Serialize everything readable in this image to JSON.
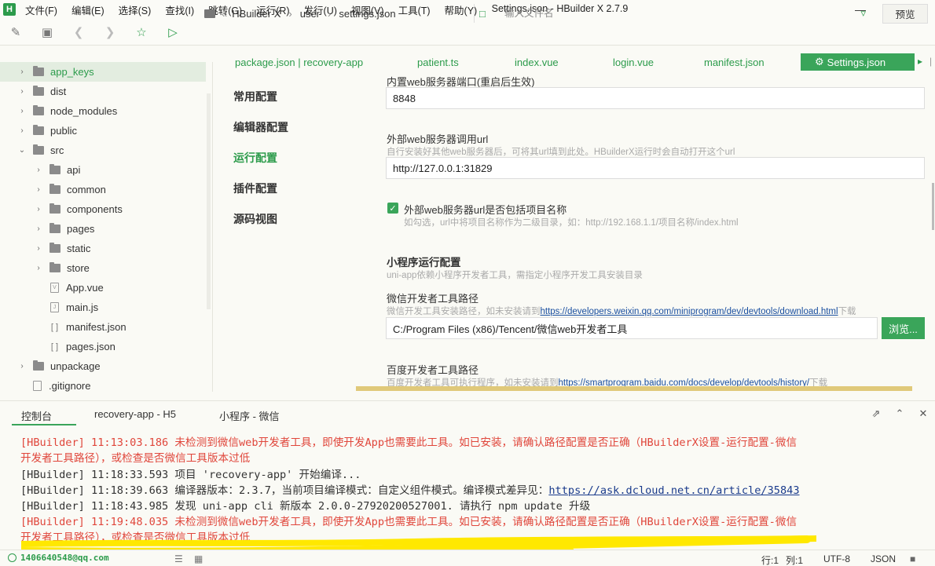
{
  "window": {
    "title": "Settings.json - HBuilder X 2.7.9",
    "logo": "H"
  },
  "menu": [
    "文件(F)",
    "编辑(E)",
    "选择(S)",
    "查找(I)",
    "跳转(G)",
    "运行(R)",
    "发行(U)",
    "视图(V)",
    "工具(T)",
    "帮助(Y)"
  ],
  "toolbar": {
    "breadcrumb": [
      "HBuilder X",
      "user",
      "settings.json"
    ],
    "file_search_placeholder": "输入文件名",
    "preview_label": "预览"
  },
  "tree": [
    {
      "label": "app_keys",
      "type": "folder",
      "level": 0,
      "expanded": false,
      "selected": true
    },
    {
      "label": "dist",
      "type": "folder",
      "level": 0,
      "expanded": false
    },
    {
      "label": "node_modules",
      "type": "folder",
      "level": 0,
      "expanded": false
    },
    {
      "label": "public",
      "type": "folder",
      "level": 0,
      "expanded": false
    },
    {
      "label": "src",
      "type": "folder",
      "level": 0,
      "expanded": true
    },
    {
      "label": "api",
      "type": "folder",
      "level": 1,
      "expanded": false
    },
    {
      "label": "common",
      "type": "folder",
      "level": 1,
      "expanded": false
    },
    {
      "label": "components",
      "type": "folder",
      "level": 1,
      "expanded": false
    },
    {
      "label": "pages",
      "type": "folder",
      "level": 1,
      "expanded": false
    },
    {
      "label": "static",
      "type": "folder",
      "level": 1,
      "expanded": false
    },
    {
      "label": "store",
      "type": "folder",
      "level": 1,
      "expanded": false
    },
    {
      "label": "App.vue",
      "type": "file",
      "level": 1,
      "glyph": "V"
    },
    {
      "label": "main.js",
      "type": "file",
      "level": 1,
      "glyph": "J"
    },
    {
      "label": "manifest.json",
      "type": "file",
      "level": 1,
      "glyph": "[ ]"
    },
    {
      "label": "pages.json",
      "type": "file",
      "level": 1,
      "glyph": "[ ]"
    },
    {
      "label": "unpackage",
      "type": "folder",
      "level": 0,
      "expanded": false
    },
    {
      "label": ".gitignore",
      "type": "file",
      "level": 0,
      "glyph": ""
    }
  ],
  "editor_tabs": [
    {
      "label": "package.json | recovery-app",
      "active": false
    },
    {
      "label": "patient.ts",
      "active": false
    },
    {
      "label": "index.vue",
      "active": false
    },
    {
      "label": "login.vue",
      "active": false
    },
    {
      "label": "manifest.json",
      "active": false
    },
    {
      "label": "Settings.json",
      "active": true
    }
  ],
  "settings_nav": [
    {
      "label": "常用配置",
      "active": false
    },
    {
      "label": "编辑器配置",
      "active": false
    },
    {
      "label": "运行配置",
      "active": true
    },
    {
      "label": "插件配置",
      "active": false
    },
    {
      "label": "源码视图",
      "active": false
    }
  ],
  "settings": {
    "builtin_port_title": "内置web服务器端口(重启后生效)",
    "builtin_port_value": "8848",
    "external_url_title": "外部web服务器调用url",
    "external_url_hint": "自行安装好其他web服务器后，可将其url填到此处。HBuilderX运行时会自动打开这个url",
    "external_url_value": "http://127.0.0.1:31829",
    "include_project_label": "外部web服务器url是否包括项目名称",
    "include_project_checked": true,
    "include_project_hint": "如勾选，url中将项目名称作为二级目录，如：http://192.168.1.1/项目名称/index.html",
    "mp_section_title": "小程序运行配置",
    "mp_section_hint": "uni-app依赖小程序开发者工具，需指定小程序开发工具安装目录",
    "wechat_title": "微信开发者工具路径",
    "wechat_hint_prefix": "微信开发工具安装路径，如未安装请到",
    "wechat_hint_link": "https://developers.weixin.qq.com/miniprogram/dev/devtools/download.html",
    "wechat_hint_suffix": "下载",
    "wechat_path": "C:/Program Files (x86)/Tencent/微信web开发者工具",
    "browse_label": "浏览...",
    "baidu_title": "百度开发者工具路径",
    "baidu_hint_prefix": "百度开发者工具可执行程序，如未安装请到",
    "baidu_hint_link": "https://smartprogram.baidu.com/docs/develop/devtools/history/",
    "baidu_hint_suffix": "下载"
  },
  "console_tabs": [
    "控制台",
    "recovery-app - H5",
    "小程序 - 微信"
  ],
  "console_lines": [
    {
      "kind": "red",
      "text": "[HBuilder] 11:13:03.186 未检测到微信web开发者工具，即使开发App也需要此工具。如已安装，请确认路径配置是否正确（HBuilderX设置-运行配置-微信"
    },
    {
      "kind": "red",
      "text": "开发者工具路径），或检查是否微信工具版本过低"
    },
    {
      "kind": "dark",
      "text": "[HBuilder] 11:18:33.593 项目 'recovery-app' 开始编译..."
    },
    {
      "kind": "dark",
      "text": "[HBuilder] 11:18:39.663 编译器版本：2.3.7，当前项目编译模式：自定义组件模式。编译模式差异见：",
      "link": "https://ask.dcloud.net.cn/article/35843"
    },
    {
      "kind": "dark",
      "text": "[HBuilder] 11:18:43.985 发现 uni-app cli 新版本 2.0.0-27920200527001. 请执行 npm update 升级"
    },
    {
      "kind": "red",
      "text": "[HBuilder] 11:19:48.035 未检测到微信web开发者工具，即使开发App也需要此工具。如已安装，请确认路径配置是否正确（HBuilderX设置-运行配置-微信"
    },
    {
      "kind": "red",
      "text": "开发者工具路径），或检查是否微信工具版本过低"
    }
  ],
  "statusbar": {
    "user": "1406640548@qq.com",
    "row": "行:1",
    "col": "列:1",
    "encoding": "UTF-8",
    "language": "JSON"
  },
  "colors": {
    "accent": "#3aa55a",
    "error": "#e0463b",
    "link": "#1a4fa0",
    "highlight_stroke": "#ffe800"
  }
}
